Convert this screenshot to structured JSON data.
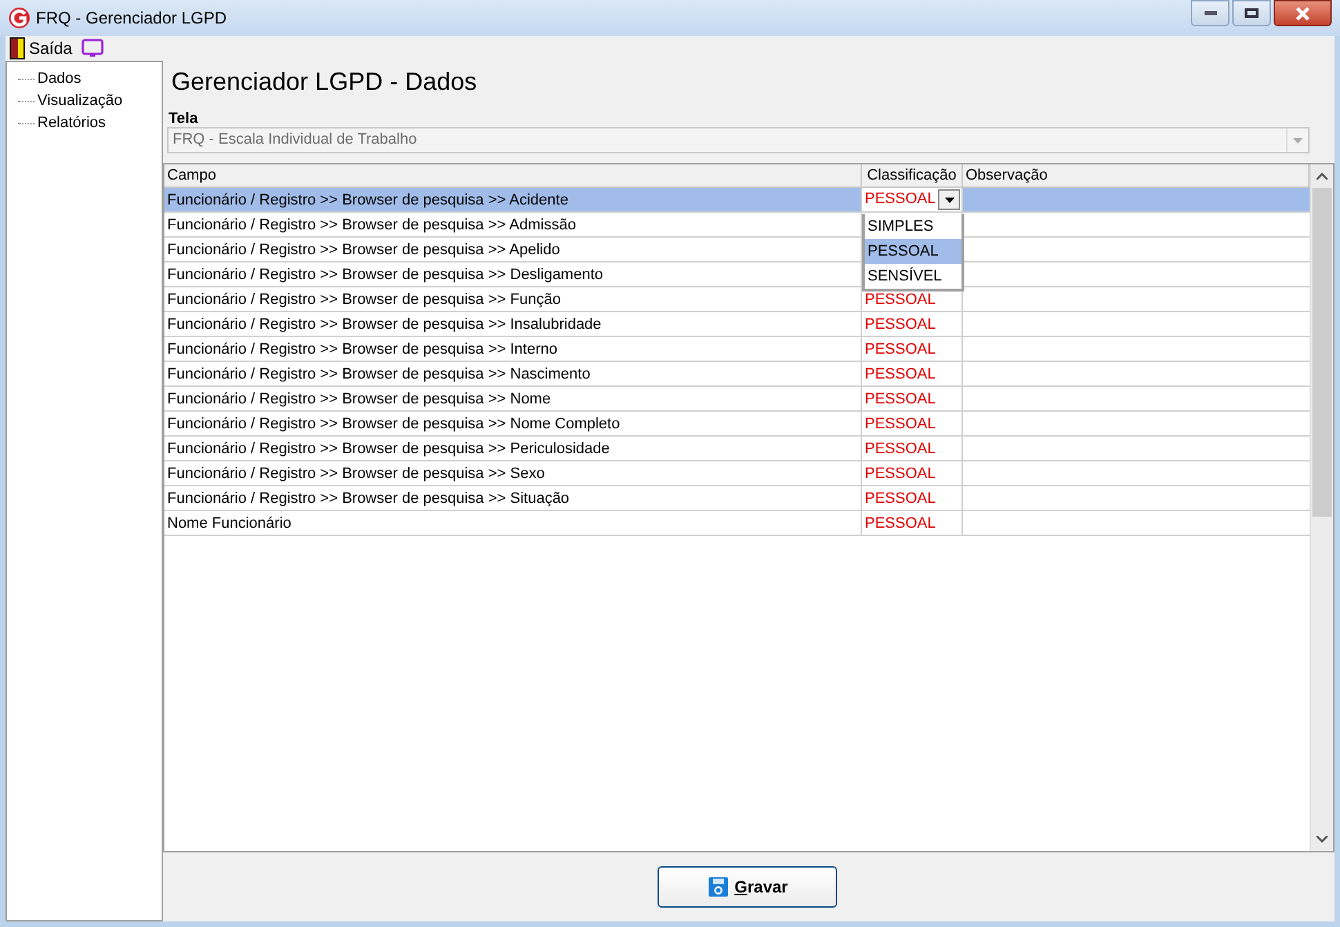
{
  "window": {
    "title": "FRQ - Gerenciador LGPD"
  },
  "menu": [
    {
      "label": "Saída"
    }
  ],
  "sidebar": {
    "items": [
      {
        "label": "Dados"
      },
      {
        "label": "Visualização"
      },
      {
        "label": "Relatórios"
      }
    ]
  },
  "heading": "Gerenciador LGPD - Dados",
  "tela": {
    "label": "Tela",
    "value": "FRQ - Escala Individual de Trabalho"
  },
  "table": {
    "columns": [
      "Campo",
      "Classificação",
      "Observação"
    ],
    "rows": [
      {
        "campo": "Funcionário / Registro >> Browser de pesquisa >> Acidente",
        "classificacao": "PESSOAL",
        "selected": true
      },
      {
        "campo": "Funcionário / Registro >> Browser de pesquisa >> Admissão",
        "selected": false
      },
      {
        "campo": "Funcionário / Registro >> Browser de pesquisa >> Apelido",
        "selected": false
      },
      {
        "campo": "Funcionário / Registro >> Browser de pesquisa >> Desligamento",
        "selected": false
      },
      {
        "campo": "Funcionário / Registro >> Browser de pesquisa >> Função",
        "classificacao": "PESSOAL",
        "selected": false
      },
      {
        "campo": "Funcionário / Registro >> Browser de pesquisa >> Insalubridade",
        "classificacao": "PESSOAL",
        "selected": false
      },
      {
        "campo": "Funcionário / Registro >> Browser de pesquisa >> Interno",
        "classificacao": "PESSOAL",
        "selected": false
      },
      {
        "campo": "Funcionário / Registro >> Browser de pesquisa >> Nascimento",
        "classificacao": "PESSOAL",
        "selected": false
      },
      {
        "campo": "Funcionário / Registro >> Browser de pesquisa >> Nome",
        "classificacao": "PESSOAL",
        "selected": false
      },
      {
        "campo": "Funcionário / Registro >> Browser de pesquisa >> Nome Completo",
        "classificacao": "PESSOAL",
        "selected": false
      },
      {
        "campo": "Funcionário / Registro >> Browser de pesquisa >> Periculosidade",
        "classificacao": "PESSOAL",
        "selected": false
      },
      {
        "campo": "Funcionário / Registro >> Browser de pesquisa >> Sexo",
        "classificacao": "PESSOAL",
        "selected": false
      },
      {
        "campo": "Funcionário / Registro >> Browser de pesquisa >> Situação",
        "classificacao": "PESSOAL",
        "selected": false
      },
      {
        "campo": "Nome Funcionário",
        "classificacao": "PESSOAL",
        "selected": false
      }
    ]
  },
  "dropdown_options": [
    {
      "label": "SIMPLES",
      "selected": false
    },
    {
      "label": "PESSOAL",
      "selected": true
    },
    {
      "label": "SENSÍVEL",
      "selected": false
    }
  ],
  "save_button": {
    "label": "Gravar"
  }
}
